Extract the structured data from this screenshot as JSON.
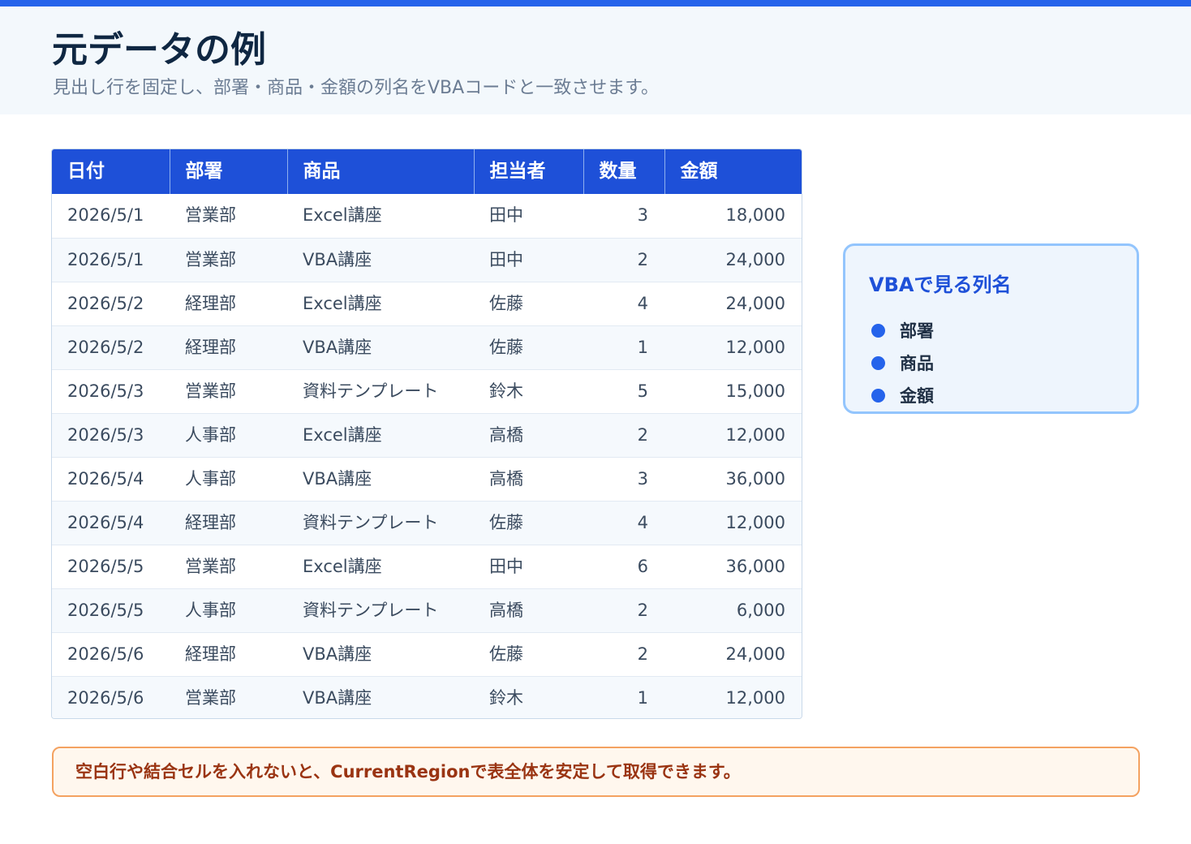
{
  "header": {
    "title": "元データの例",
    "subtitle": "見出し行を固定し、部署・商品・金額の列名をVBAコードと一致させます。"
  },
  "table": {
    "columns": [
      "日付",
      "部署",
      "商品",
      "担当者",
      "数量",
      "金額"
    ],
    "rows": [
      [
        "2026/5/1",
        "営業部",
        "Excel講座",
        "田中",
        "3",
        "18,000"
      ],
      [
        "2026/5/1",
        "営業部",
        "VBA講座",
        "田中",
        "2",
        "24,000"
      ],
      [
        "2026/5/2",
        "経理部",
        "Excel講座",
        "佐藤",
        "4",
        "24,000"
      ],
      [
        "2026/5/2",
        "経理部",
        "VBA講座",
        "佐藤",
        "1",
        "12,000"
      ],
      [
        "2026/5/3",
        "営業部",
        "資料テンプレート",
        "鈴木",
        "5",
        "15,000"
      ],
      [
        "2026/5/3",
        "人事部",
        "Excel講座",
        "高橋",
        "2",
        "12,000"
      ],
      [
        "2026/5/4",
        "人事部",
        "VBA講座",
        "高橋",
        "3",
        "36,000"
      ],
      [
        "2026/5/4",
        "経理部",
        "資料テンプレート",
        "佐藤",
        "4",
        "12,000"
      ],
      [
        "2026/5/5",
        "営業部",
        "Excel講座",
        "田中",
        "6",
        "36,000"
      ],
      [
        "2026/5/5",
        "人事部",
        "資料テンプレート",
        "高橋",
        "2",
        "6,000"
      ],
      [
        "2026/5/6",
        "経理部",
        "VBA講座",
        "佐藤",
        "2",
        "24,000"
      ],
      [
        "2026/5/6",
        "営業部",
        "VBA講座",
        "鈴木",
        "1",
        "12,000"
      ]
    ]
  },
  "side_card": {
    "title": "VBAで見る列名",
    "items": [
      "部署",
      "商品",
      "金額"
    ]
  },
  "note": {
    "text": "空白行や結合セルを入れないと、CurrentRegionで表全体を安定して取得できます。"
  },
  "colors": {
    "accent": "#2563eb",
    "table_header": "#1e50d8",
    "card_border": "#93c5fd",
    "note_border": "#f4a261",
    "note_text": "#9a3412"
  }
}
